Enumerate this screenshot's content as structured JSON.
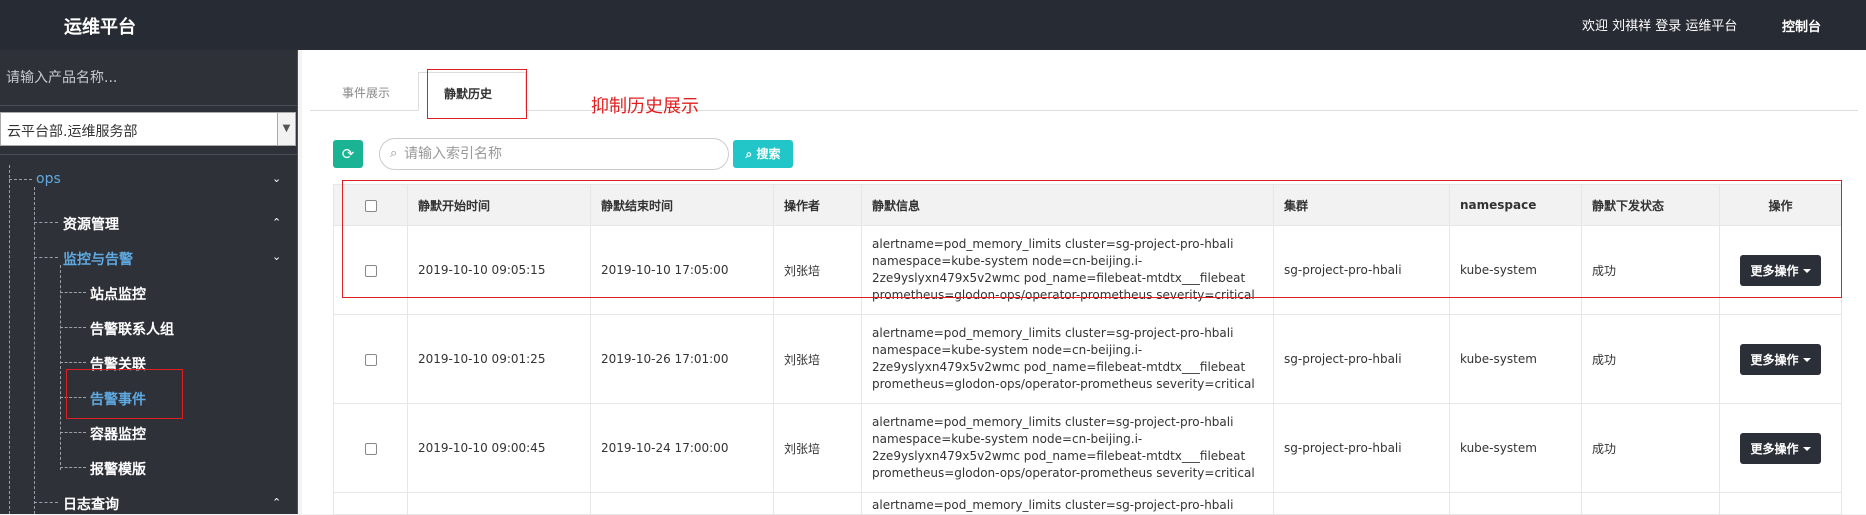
{
  "header": {
    "brand": "运维平台",
    "welcome": "欢迎 刘祺祥 登录 运维平台",
    "console": "控制台"
  },
  "sidebar": {
    "search_placeholder": "请输入产品名称...",
    "select_value": "云平台部.运维服务部",
    "items": [
      {
        "label": "ops"
      },
      {
        "label": "资源管理"
      },
      {
        "label": "监控与告警"
      },
      {
        "label": "站点监控"
      },
      {
        "label": "告警联系人组"
      },
      {
        "label": "告警关联"
      },
      {
        "label": "告警事件"
      },
      {
        "label": "容器监控"
      },
      {
        "label": "报警模版"
      },
      {
        "label": "日志查询"
      }
    ]
  },
  "tabs": [
    {
      "label": "事件展示"
    },
    {
      "label": "静默历史"
    }
  ],
  "annotation": "抑制历史展示",
  "toolbar": {
    "search_placeholder": "请输入索引名称",
    "search_label": "搜索"
  },
  "table": {
    "headers": [
      "静默开始时间",
      "静默结束时间",
      "操作者",
      "静默信息",
      "集群",
      "namespace",
      "静默下发状态",
      "操作"
    ],
    "rows": [
      {
        "start": "2019-10-10 09:05:15",
        "end": "2019-10-10 17:05:00",
        "operator": "刘张培",
        "info": "alertname=pod_memory_limits cluster=sg-project-pro-hbali namespace=kube-system node=cn-beijing.i-2ze9yslyxn479x5v2wmc pod_name=filebeat-mtdtx___filebeat prometheus=glodon-ops/operator-prometheus severity=critical",
        "cluster": "sg-project-pro-hbali",
        "namespace": "kube-system",
        "status": "成功",
        "action": "更多操作"
      },
      {
        "start": "2019-10-10 09:01:25",
        "end": "2019-10-26 17:01:00",
        "operator": "刘张培",
        "info": "alertname=pod_memory_limits cluster=sg-project-pro-hbali namespace=kube-system node=cn-beijing.i-2ze9yslyxn479x5v2wmc pod_name=filebeat-mtdtx___filebeat prometheus=glodon-ops/operator-prometheus severity=critical",
        "cluster": "sg-project-pro-hbali",
        "namespace": "kube-system",
        "status": "成功",
        "action": "更多操作"
      },
      {
        "start": "2019-10-10 09:00:45",
        "end": "2019-10-24 17:00:00",
        "operator": "刘张培",
        "info": "alertname=pod_memory_limits cluster=sg-project-pro-hbali namespace=kube-system node=cn-beijing.i-2ze9yslyxn479x5v2wmc pod_name=filebeat-mtdtx___filebeat prometheus=glodon-ops/operator-prometheus severity=critical",
        "cluster": "sg-project-pro-hbali",
        "namespace": "kube-system",
        "status": "成功",
        "action": "更多操作"
      },
      {
        "info": "alertname=pod_memory_limits cluster=sg-project-pro-hbali"
      }
    ]
  }
}
